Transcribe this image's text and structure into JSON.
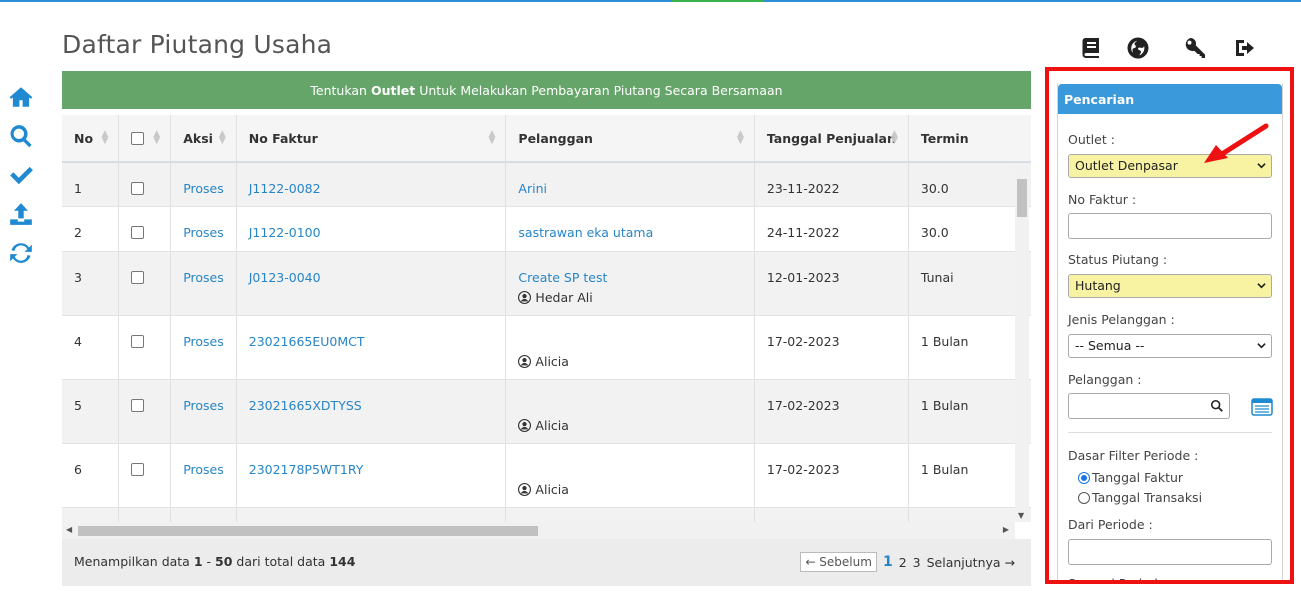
{
  "page_title": "Daftar Piutang Usaha",
  "banner": {
    "prefix": "Tentukan",
    "bold": "Outlet",
    "suffix": "Untuk Melakukan Pembayaran Piutang Secara Bersamaan"
  },
  "table": {
    "headers": {
      "no": "No",
      "aksi": "Aksi",
      "no_faktur": "No Faktur",
      "pelanggan": "Pelanggan",
      "tanggal": "Tanggal Penjualan",
      "termin": "Termin"
    },
    "rows": [
      {
        "no": "1",
        "aksi": "Proses",
        "faktur": "J1122-0082",
        "pelanggan": "Arini",
        "user": "",
        "tanggal": "23-11-2022",
        "termin": "30.0"
      },
      {
        "no": "2",
        "aksi": "Proses",
        "faktur": "J1122-0100",
        "pelanggan": "sastrawan eka utama",
        "user": "",
        "tanggal": "24-11-2022",
        "termin": "30.0"
      },
      {
        "no": "3",
        "aksi": "Proses",
        "faktur": "J0123-0040",
        "pelanggan": "Create SP test",
        "user": "Hedar Ali",
        "tanggal": "12-01-2023",
        "termin": "Tunai"
      },
      {
        "no": "4",
        "aksi": "Proses",
        "faktur": "23021665EU0MCT",
        "pelanggan": "",
        "user": "Alicia",
        "tanggal": "17-02-2023",
        "termin": "1 Bulan"
      },
      {
        "no": "5",
        "aksi": "Proses",
        "faktur": "23021665XDTYSS",
        "pelanggan": "",
        "user": "Alicia",
        "tanggal": "17-02-2023",
        "termin": "1 Bulan"
      },
      {
        "no": "6",
        "aksi": "Proses",
        "faktur": "2302178P5WT1RY",
        "pelanggan": "",
        "user": "Alicia",
        "tanggal": "17-02-2023",
        "termin": "1 Bulan"
      }
    ]
  },
  "footer": {
    "prefix": "Menampilkan data",
    "from": "1",
    "dash": "-",
    "to": "50",
    "mid": "dari total data",
    "total": "144"
  },
  "pager": {
    "prev": "← Sebelum",
    "current": "1",
    "p2": "2",
    "p3": "3",
    "next": "Selanjutnya →"
  },
  "sidebar": {
    "title": "Pencarian",
    "outlet_label": "Outlet :",
    "outlet_value": "Outlet Denpasar",
    "faktur_label": "No Faktur :",
    "faktur_value": "",
    "status_label": "Status Piutang :",
    "status_value": "Hutang",
    "jenis_label": "Jenis Pelanggan :",
    "jenis_value": "-- Semua --",
    "pelanggan_label": "Pelanggan :",
    "pelanggan_value": "",
    "dasar_label": "Dasar Filter Periode :",
    "radio1": "Tanggal Faktur",
    "radio2": "Tanggal Transaksi",
    "dari_label": "Dari Periode :",
    "dari_value": "",
    "sampai_label": "Sampai Periode :"
  },
  "colors": {
    "accent": "#1f8ad1",
    "banner": "#66a56a",
    "highlight_border": "#ee1111",
    "select_highlight": "#f7f3a3"
  },
  "icons": {
    "nav": [
      "home-icon",
      "search-icon",
      "check-icon",
      "upload-icon",
      "refresh-icon"
    ],
    "top": [
      "book-icon",
      "globe-icon",
      "key-icon",
      "sign-out-icon"
    ]
  }
}
